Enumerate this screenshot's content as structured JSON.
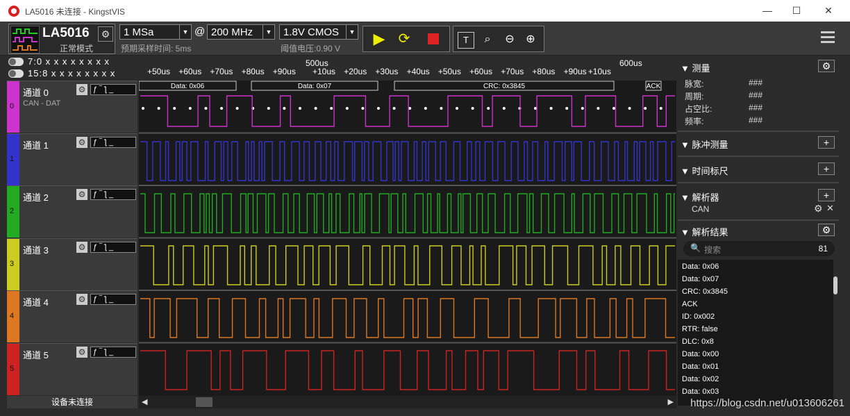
{
  "window": {
    "title": "LA5016 未连接 - KingstVIS",
    "minimize": "—",
    "maximize": "☐",
    "close": "✕"
  },
  "toolbar": {
    "device_name": "LA5016",
    "device_mode": "正常模式",
    "sample_depth": "1 MSa",
    "at": "@",
    "sample_rate": "200 MHz",
    "sample_time_label": "预期采样时间: 5ms",
    "threshold": "1.8V CMOS",
    "threshold_label": "阈值电压:0.90 V"
  },
  "toggles": [
    {
      "label": "7:0  x x x x x x x x"
    },
    {
      "label": "15:8 x x x x x x x x"
    }
  ],
  "channels": [
    {
      "num": "0",
      "name": "通道 0",
      "sub": "CAN - DAT",
      "color": "#cc33cc"
    },
    {
      "num": "1",
      "name": "通道 1",
      "sub": "",
      "color": "#3333cc"
    },
    {
      "num": "2",
      "name": "通道 2",
      "sub": "",
      "color": "#22aa22"
    },
    {
      "num": "3",
      "name": "通道 3",
      "sub": "",
      "color": "#cccc22"
    },
    {
      "num": "4",
      "name": "通道 4",
      "sub": "",
      "color": "#dd7722"
    },
    {
      "num": "5",
      "name": "通道 5",
      "sub": "",
      "color": "#cc2222"
    }
  ],
  "status": "设备未连接",
  "ruler": {
    "major": [
      "500us",
      "600us"
    ],
    "minor": [
      "+50us",
      "+60us",
      "+70us",
      "+80us",
      "+90us",
      "+10us",
      "+20us",
      "+30us",
      "+40us",
      "+50us",
      "+60us",
      "+70us",
      "+80us",
      "+90us",
      "+10us"
    ]
  },
  "decode_labels": [
    "Data: 0x06",
    "Data: 0x07",
    "CRC: 0x3845",
    "ACK"
  ],
  "right_panel": {
    "measure": {
      "title": "测量",
      "rows": [
        [
          "脉宽:",
          "###"
        ],
        [
          "周期:",
          "###"
        ],
        [
          "占空比:",
          "###"
        ],
        [
          "频率:",
          "###"
        ]
      ]
    },
    "pulse": {
      "title": "脉冲测量"
    },
    "timer": {
      "title": "时间标尺"
    },
    "analyzer": {
      "title": "解析器",
      "item": "CAN"
    },
    "results": {
      "title": "解析结果",
      "search_placeholder": "搜索",
      "count": "81",
      "items": [
        "Data: 0x06",
        "Data: 0x07",
        "CRC: 0x3845",
        "ACK",
        "ID: 0x002",
        "RTR: false",
        "DLC: 0x8",
        "Data: 0x00",
        "Data: 0x01",
        "Data: 0x02",
        "Data: 0x03"
      ]
    }
  },
  "watermark": "https://blog.csdn.net/u013606261"
}
